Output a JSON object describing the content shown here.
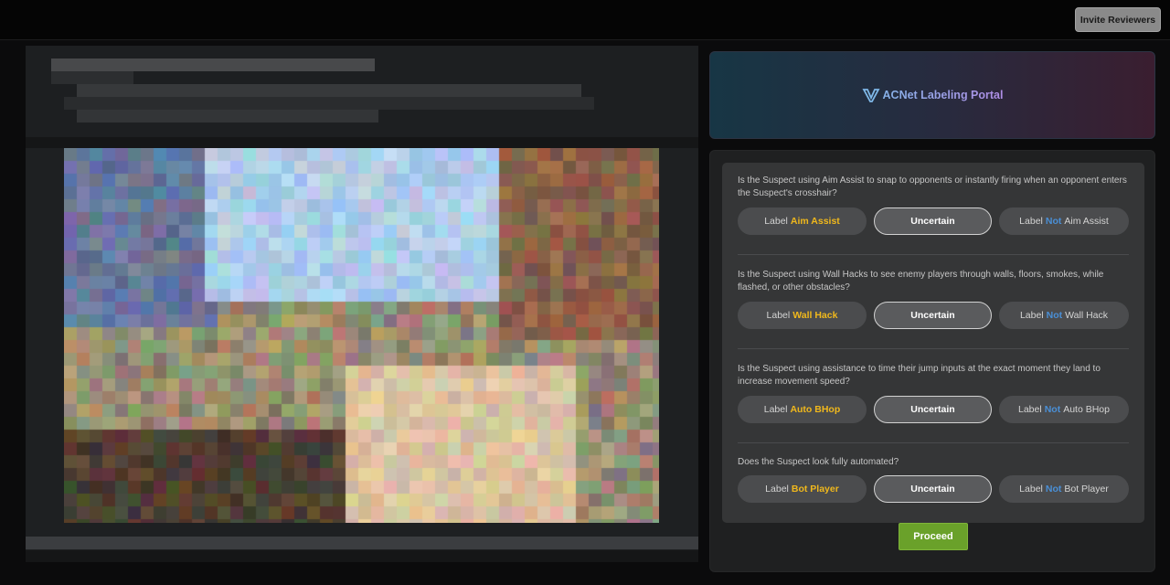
{
  "header": {
    "invite_label": "Invite Reviewers"
  },
  "portal": {
    "title": "ACNet Labeling Portal",
    "logo_icon": "v-shield-icon"
  },
  "questions": [
    {
      "text": "Is the Suspect using Aim Assist to snap to opponents or instantly firing when an opponent enters the Suspect's crosshair?",
      "label_prefix": "Label",
      "label_term": "Aim Assist",
      "uncertain": "Uncertain",
      "not_prefix": "Label",
      "not_word": "Not",
      "not_term": "Aim Assist"
    },
    {
      "text": "Is the Suspect using Wall Hacks to see enemy players through walls, floors, smokes, while flashed, or other obstacles?",
      "label_prefix": "Label",
      "label_term": "Wall Hack",
      "uncertain": "Uncertain",
      "not_prefix": "Label",
      "not_word": "Not",
      "not_term": "Wall Hack"
    },
    {
      "text": "Is the Suspect using assistance to time their jump inputs at the exact moment they land to increase movement speed?",
      "label_prefix": "Label",
      "label_term": "Auto BHop",
      "uncertain": "Uncertain",
      "not_prefix": "Label",
      "not_word": "Not",
      "not_term": "Auto BHop"
    },
    {
      "text": "Does the Suspect look fully automated?",
      "label_prefix": "Label",
      "label_term": "Bot Player",
      "uncertain": "Uncertain",
      "not_prefix": "Label",
      "not_word": "Not",
      "not_term": "Bot Player"
    }
  ],
  "proceed_label": "Proceed",
  "colors": {
    "highlight_yellow": "#f0b81c",
    "highlight_blue": "#4a8fd6",
    "proceed_green": "#6aa12a"
  }
}
